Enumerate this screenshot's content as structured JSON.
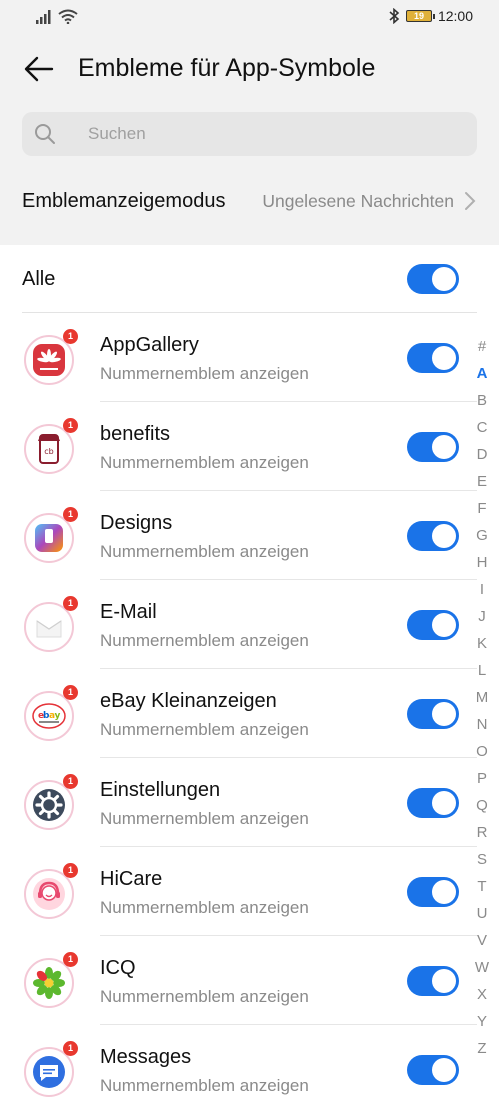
{
  "status_bar": {
    "time": "12:00",
    "battery": "19"
  },
  "header": {
    "title": "Embleme für App-Symbole"
  },
  "search": {
    "placeholder": "Suchen"
  },
  "mode": {
    "label": "Emblemanzeigemodus",
    "value": "Ungelesene Nachrichten"
  },
  "all": {
    "label": "Alle",
    "enabled": true
  },
  "apps": [
    {
      "name": "AppGallery",
      "subtitle": "Nummernemblem anzeigen",
      "badge": "1",
      "enabled": true,
      "icon": "huawei-appgallery-icon"
    },
    {
      "name": "benefits",
      "subtitle": "Nummernemblem anzeigen",
      "badge": "1",
      "enabled": true,
      "icon": "benefits-icon"
    },
    {
      "name": "Designs",
      "subtitle": "Nummernemblem anzeigen",
      "badge": "1",
      "enabled": true,
      "icon": "designs-icon"
    },
    {
      "name": "E-Mail",
      "subtitle": "Nummernemblem anzeigen",
      "badge": "1",
      "enabled": true,
      "icon": "email-icon"
    },
    {
      "name": "eBay Kleinanzeigen",
      "subtitle": "Nummernemblem anzeigen",
      "badge": "1",
      "enabled": true,
      "icon": "ebay-kleinanzeigen-icon"
    },
    {
      "name": "Einstellungen",
      "subtitle": "Nummernemblem anzeigen",
      "badge": "1",
      "enabled": true,
      "icon": "settings-gear-icon"
    },
    {
      "name": "HiCare",
      "subtitle": "Nummernemblem anzeigen",
      "badge": "1",
      "enabled": true,
      "icon": "hicare-icon"
    },
    {
      "name": "ICQ",
      "subtitle": "Nummernemblem anzeigen",
      "badge": "1",
      "enabled": true,
      "icon": "icq-flower-icon"
    },
    {
      "name": "Messages",
      "subtitle": "Nummernemblem anzeigen",
      "badge": "1",
      "enabled": true,
      "icon": "messages-icon"
    }
  ],
  "alphabet": [
    "#",
    "A",
    "B",
    "C",
    "D",
    "E",
    "F",
    "G",
    "H",
    "I",
    "J",
    "K",
    "L",
    "M",
    "N",
    "O",
    "P",
    "Q",
    "R",
    "S",
    "T",
    "U",
    "V",
    "W",
    "X",
    "Y",
    "Z"
  ],
  "alphabet_active": "A",
  "colors": {
    "accent": "#1a73e8",
    "badge": "#e8382f"
  }
}
